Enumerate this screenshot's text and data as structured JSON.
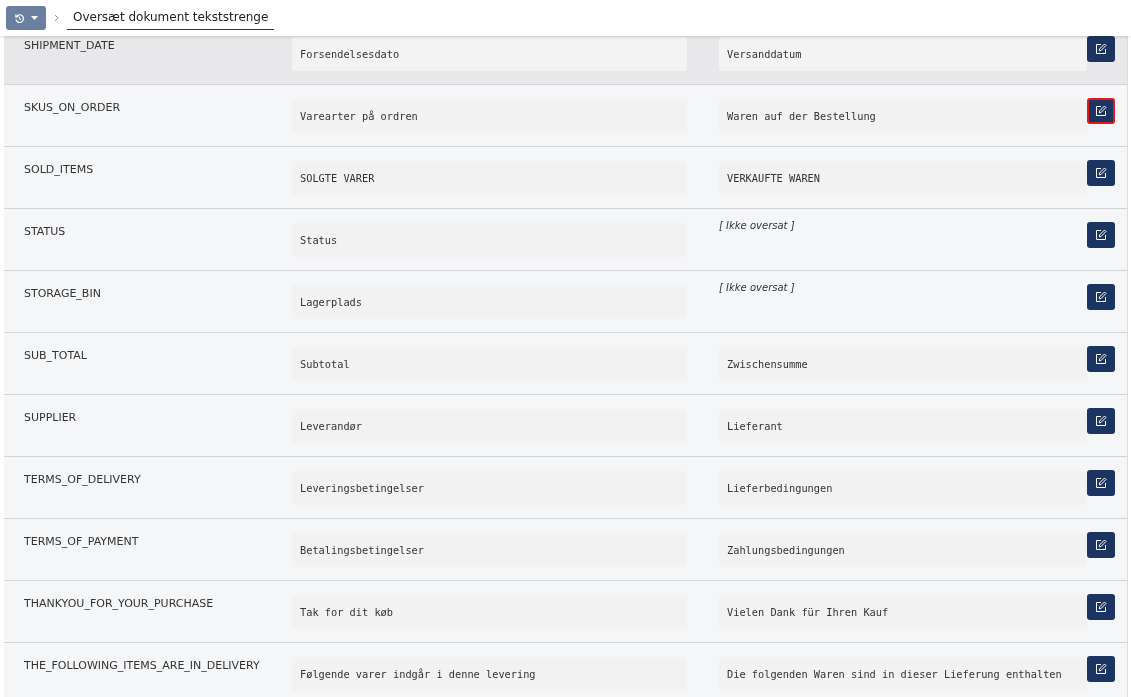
{
  "toolbar": {
    "history_button": {
      "expanded": false
    },
    "breadcrumb": {
      "title": "Oversæt dokument tekststrenge",
      "selected": true
    }
  },
  "rows": [
    {
      "key": "SHIPMENT_DATE",
      "source": "Forsendelsesdato",
      "translation": "Versanddatum",
      "translated": true,
      "hovered": true,
      "focused": false
    },
    {
      "key": "SKUS_ON_ORDER",
      "source": "Varearter på ordren",
      "translation": "Waren auf der Bestellung",
      "translated": true,
      "hovered": false,
      "focused": true
    },
    {
      "key": "SOLD_ITEMS",
      "source": "SOLGTE VARER",
      "translation": "VERKAUFTE WAREN",
      "translated": true,
      "hovered": false,
      "focused": false
    },
    {
      "key": "STATUS",
      "source": "Status",
      "translation": "[ Ikke oversat ]",
      "translated": false,
      "hovered": false,
      "focused": false
    },
    {
      "key": "STORAGE_BIN",
      "source": "Lagerplads",
      "translation": "[ Ikke oversat ]",
      "translated": false,
      "hovered": false,
      "focused": false
    },
    {
      "key": "SUB_TOTAL",
      "source": "Subtotal",
      "translation": "Zwischensumme",
      "translated": true,
      "hovered": false,
      "focused": false
    },
    {
      "key": "SUPPLIER",
      "source": "Leverandør",
      "translation": "Lieferant",
      "translated": true,
      "hovered": false,
      "focused": false
    },
    {
      "key": "TERMS_OF_DELIVERY",
      "source": "Leveringsbetingelser",
      "translation": "Lieferbedingungen",
      "translated": true,
      "hovered": false,
      "focused": false
    },
    {
      "key": "TERMS_OF_PAYMENT",
      "source": "Betalingsbetingelser",
      "translation": "Zahlungsbedingungen",
      "translated": true,
      "hovered": false,
      "focused": false
    },
    {
      "key": "THANKYOU_FOR_YOUR_PURCHASE",
      "source": "Tak for dit køb",
      "translation": "Vielen Dank für Ihren Kauf",
      "translated": true,
      "hovered": false,
      "focused": false
    },
    {
      "key": "THE_FOLLOWING_ITEMS_ARE_IN_DELIVERY",
      "source": "Følgende varer indgår i denne levering",
      "translation": "Die folgenden Waren sind in dieser Lieferung enthalten",
      "translated": true,
      "hovered": false,
      "focused": false
    }
  ]
}
